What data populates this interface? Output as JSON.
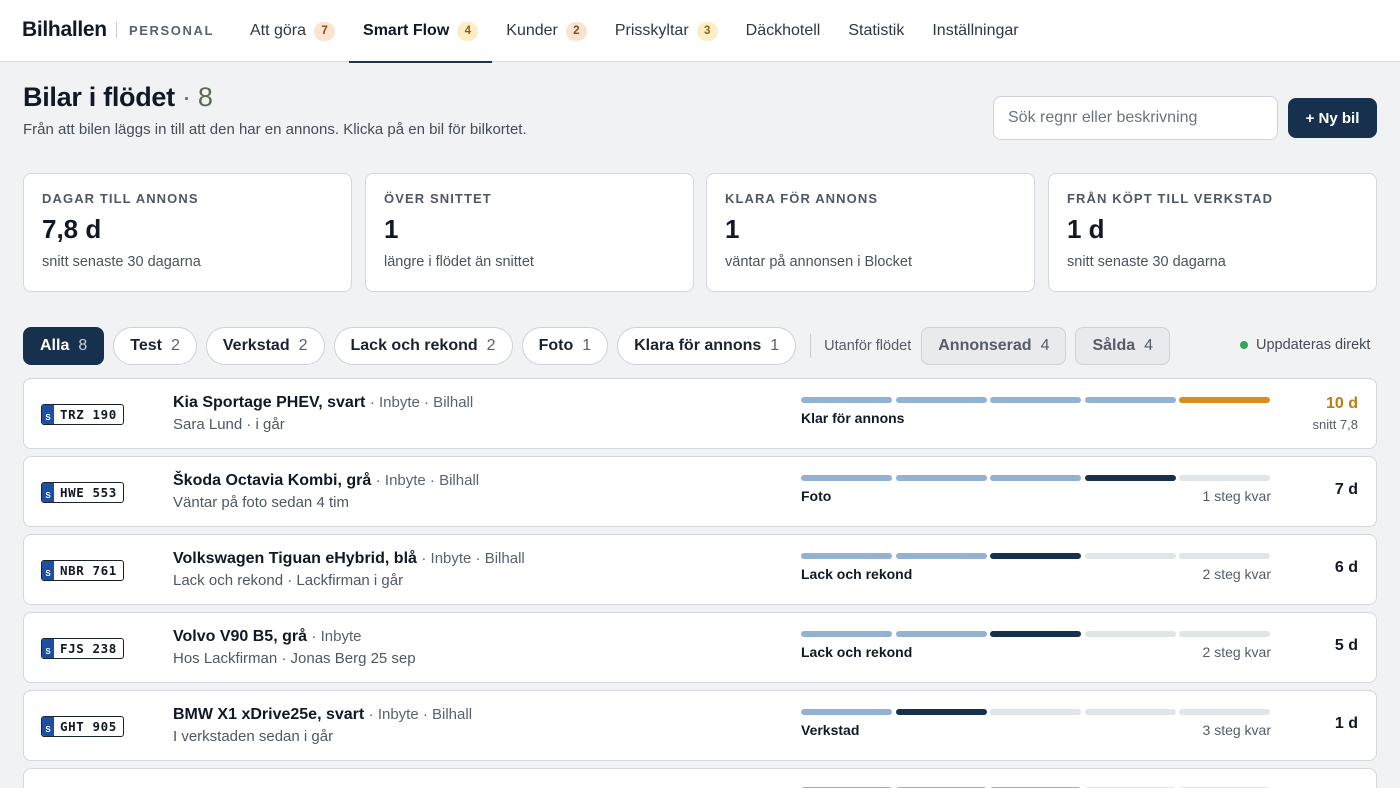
{
  "brand": {
    "name": "Bilhallen",
    "sub": "PERSONAL"
  },
  "nav": {
    "tabs": [
      {
        "label": "Att göra",
        "badge": "7"
      },
      {
        "label": "Smart Flow",
        "badge": "4"
      },
      {
        "label": "Kunder",
        "badge": "2"
      },
      {
        "label": "Prisskyltar",
        "badge": "3"
      },
      {
        "label": "Däckhotell"
      },
      {
        "label": "Statistik"
      },
      {
        "label": "Inställningar"
      }
    ]
  },
  "header": {
    "title": "Bilar i flödet",
    "count": "· 8",
    "subtitle": "Från att bilen läggs in till att den har en annons. Klicka på en bil för bilkortet.",
    "search_placeholder": "Sök regnr eller beskrivning",
    "new_button": "+ Ny bil"
  },
  "stats": [
    {
      "label": "DAGAR TILL ANNONS",
      "value": "7,8 d",
      "desc": "snitt senaste 30 dagarna"
    },
    {
      "label": "ÖVER SNITTET",
      "value": "1",
      "desc": "längre i flödet än snittet"
    },
    {
      "label": "KLARA FÖR ANNONS",
      "value": "1",
      "desc": "väntar på annonsen i Blocket"
    },
    {
      "label": "FRÅN KÖPT TILL VERKSTAD",
      "value": "1 d",
      "desc": "snitt senaste 30 dagarna"
    }
  ],
  "filters": {
    "flow": [
      {
        "label": "Alla",
        "count": "8"
      },
      {
        "label": "Test",
        "count": "2"
      },
      {
        "label": "Verkstad",
        "count": "2"
      },
      {
        "label": "Lack och rekond",
        "count": "2"
      },
      {
        "label": "Foto",
        "count": "1"
      },
      {
        "label": "Klara för annons",
        "count": "1"
      }
    ],
    "outside_label": "Utanför flödet",
    "outside": [
      {
        "label": "Annonserad",
        "count": "4"
      },
      {
        "label": "Sålda",
        "count": "4"
      }
    ],
    "live_label": "Uppdateras direkt"
  },
  "cars": [
    {
      "plate_prefix": "S",
      "plate": "TRZ 190",
      "title": "Kia Sportage PHEV, svart",
      "meta": "· Inbyte · Bilhall",
      "sub": "Sara Lund · i går",
      "stage": "Klar för annons",
      "steps_left": "",
      "days": "10 d",
      "avg": "snitt 7,8",
      "progress": [
        "done",
        "done",
        "done",
        "done",
        "warn"
      ]
    },
    {
      "plate_prefix": "S",
      "plate": "HWE 553",
      "title": "Škoda Octavia Kombi, grå",
      "meta": "· Inbyte · Bilhall",
      "sub": "Väntar på foto sedan 4 tim",
      "stage": "Foto",
      "steps_left": "1 steg kvar",
      "days": "7 d",
      "avg": "",
      "progress": [
        "done",
        "done",
        "done",
        "current",
        "todo"
      ]
    },
    {
      "plate_prefix": "S",
      "plate": "NBR 761",
      "title": "Volkswagen Tiguan eHybrid, blå",
      "meta": "· Inbyte · Bilhall",
      "sub": "Lack och rekond · Lackfirman i går",
      "stage": "Lack och rekond",
      "steps_left": "2 steg kvar",
      "days": "6 d",
      "avg": "",
      "progress": [
        "done",
        "done",
        "current",
        "todo",
        "todo"
      ]
    },
    {
      "plate_prefix": "S",
      "plate": "FJS 238",
      "title": "Volvo V90 B5, grå",
      "meta": "· Inbyte",
      "sub": "Hos Lackfirman · Jonas Berg 25 sep",
      "stage": "Lack och rekond",
      "steps_left": "2 steg kvar",
      "days": "5 d",
      "avg": "",
      "progress": [
        "done",
        "done",
        "current",
        "todo",
        "todo"
      ]
    },
    {
      "plate_prefix": "S",
      "plate": "GHT 905",
      "title": "BMW X1 xDrive25e, svart",
      "meta": "· Inbyte · Bilhall",
      "sub": "I verkstaden sedan i går",
      "stage": "Verkstad",
      "steps_left": "3 steg kvar",
      "days": "1 d",
      "avg": "",
      "progress": [
        "done",
        "current",
        "todo",
        "todo",
        "todo"
      ]
    },
    {
      "plate_prefix": "S",
      "plate": "",
      "title": "",
      "meta": "",
      "sub": "",
      "stage": "",
      "steps_left": "",
      "days": "",
      "avg": "",
      "progress": [
        "done",
        "done",
        "done",
        "todo",
        "todo"
      ]
    }
  ]
}
